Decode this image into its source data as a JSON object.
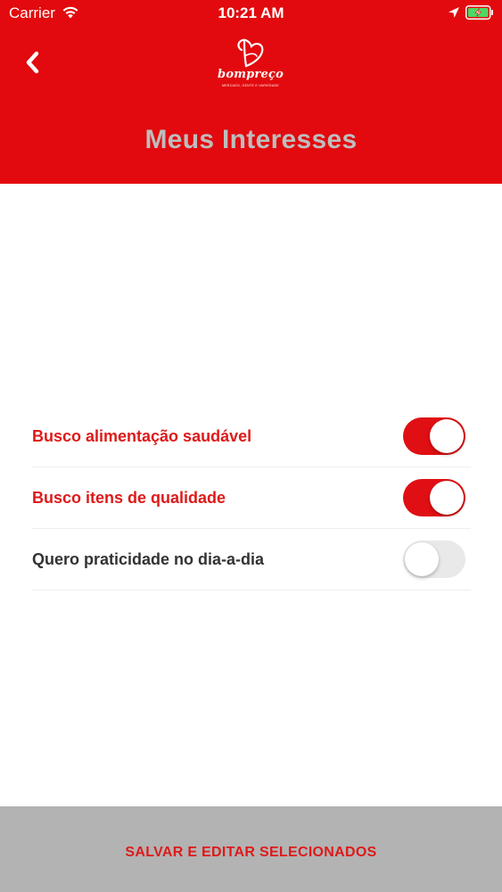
{
  "status_bar": {
    "carrier": "Carrier",
    "time": "10:21 AM",
    "icons": [
      "wifi-icon",
      "location-icon",
      "battery-icon"
    ]
  },
  "header": {
    "logo": {
      "brand": "bompreço",
      "tagline": "MERCADO, GENTE E VARIEDADE"
    },
    "title": "Meus Interesses",
    "back_icon": "chevron-left-icon"
  },
  "interests": [
    {
      "label": "Busco alimentação saudável",
      "enabled": true
    },
    {
      "label": "Busco itens de qualidade",
      "enabled": true
    },
    {
      "label": "Quero praticidade no dia-a-dia",
      "enabled": false
    }
  ],
  "footer": {
    "button_label": "SALVAR E EDITAR SELECIONADOS"
  },
  "colors": {
    "brand_red": "#e20a0e",
    "title_gray": "#bdbdbd",
    "selected_text": "#de1a1a",
    "unselected_text": "#333333",
    "footer_bg": "#b3b3b3"
  }
}
